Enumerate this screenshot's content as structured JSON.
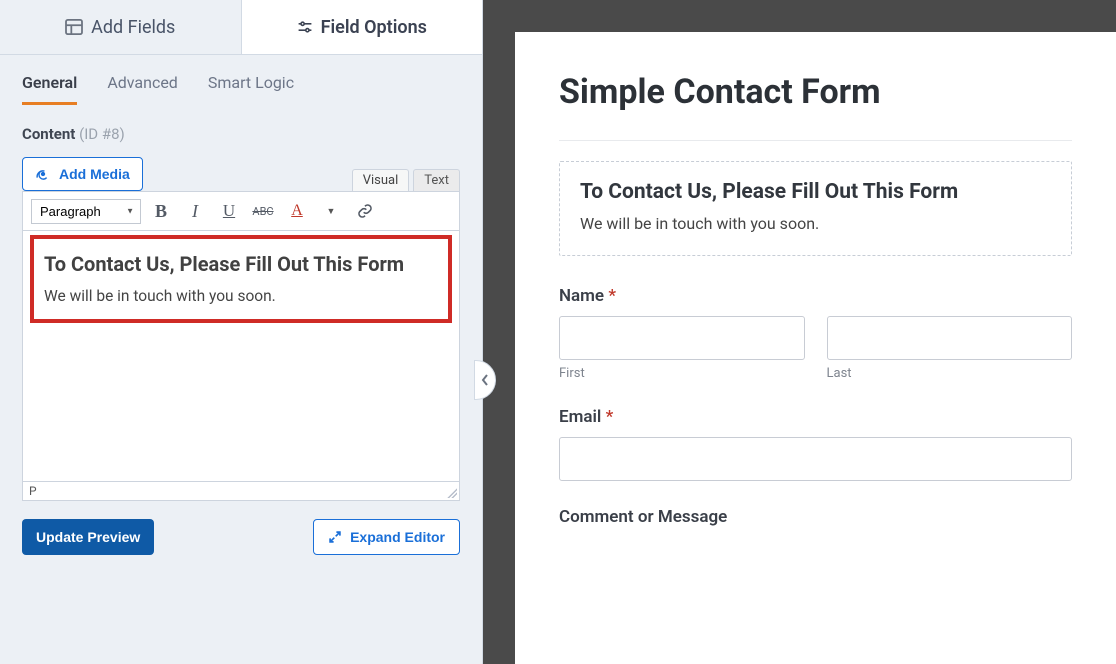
{
  "top_tabs": {
    "add_fields": "Add Fields",
    "field_options": "Field Options"
  },
  "sub_tabs": {
    "general": "General",
    "advanced": "Advanced",
    "smart_logic": "Smart Logic"
  },
  "content": {
    "label": "Content",
    "id_text": "(ID #8)"
  },
  "media_button": "Add Media",
  "editor_tabs": {
    "visual": "Visual",
    "text": "Text"
  },
  "toolbar": {
    "format": "Paragraph"
  },
  "editor": {
    "heading": "To Contact Us, Please Fill Out This Form",
    "paragraph": "We will be in touch with you soon.",
    "path": "P"
  },
  "bottom": {
    "update": "Update Preview",
    "expand": "Expand Editor"
  },
  "preview": {
    "title": "Simple Contact Form",
    "html_block": {
      "heading": "To Contact Us, Please Fill Out This Form",
      "paragraph": "We will be in touch with you soon."
    },
    "name": {
      "label": "Name",
      "first": "First",
      "last": "Last"
    },
    "email": {
      "label": "Email"
    },
    "comment": {
      "label": "Comment or Message"
    },
    "required_mark": "*"
  }
}
